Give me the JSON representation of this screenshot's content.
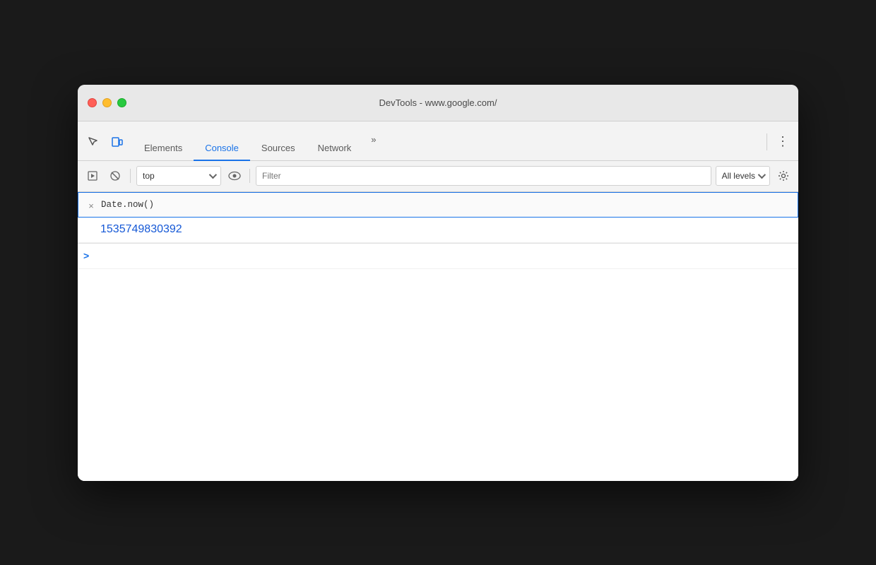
{
  "window": {
    "title": "DevTools - www.google.com/"
  },
  "traffic_lights": {
    "close_label": "close",
    "minimize_label": "minimize",
    "maximize_label": "maximize"
  },
  "tabs": {
    "items": [
      {
        "id": "elements",
        "label": "Elements",
        "active": false
      },
      {
        "id": "console",
        "label": "Console",
        "active": true
      },
      {
        "id": "sources",
        "label": "Sources",
        "active": false
      },
      {
        "id": "network",
        "label": "Network",
        "active": false
      }
    ],
    "more_label": "»",
    "menu_label": "⋮"
  },
  "toolbar": {
    "run_snippet_label": "▶",
    "clear_label": "🚫",
    "context_select": {
      "value": "top",
      "placeholder": "top"
    },
    "filter": {
      "placeholder": "Filter",
      "value": ""
    },
    "levels": {
      "label": "All levels",
      "value": "all"
    },
    "settings_label": "⚙"
  },
  "console": {
    "input_entry": {
      "cancel_label": "×",
      "code": "Date.now()"
    },
    "result": {
      "value": "1535749830392"
    },
    "prompt": {
      "icon": ">"
    }
  },
  "colors": {
    "active_tab": "#1a73e8",
    "result_value": "#1558d6",
    "prompt_icon": "#1a73e8"
  }
}
